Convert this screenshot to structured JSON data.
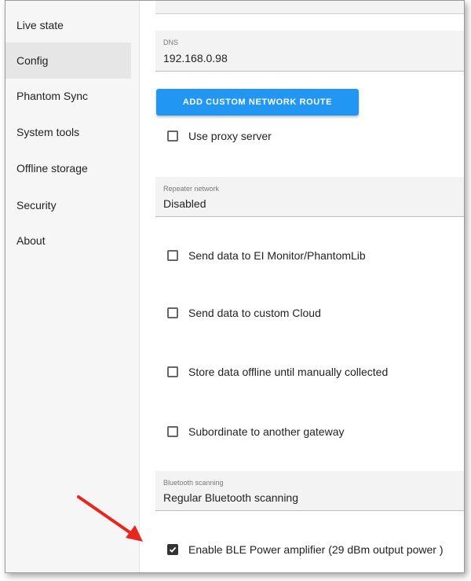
{
  "sidebar": {
    "items": [
      {
        "label": "Live state",
        "active": false
      },
      {
        "label": "Config",
        "active": true
      },
      {
        "label": "Phantom Sync",
        "active": false
      },
      {
        "label": "System tools",
        "active": false
      },
      {
        "label": "Offline storage",
        "active": false
      },
      {
        "label": "Security",
        "active": false
      },
      {
        "label": "About",
        "active": false
      }
    ]
  },
  "main": {
    "dns": {
      "label": "DNS",
      "value": "192.168.0.98"
    },
    "add_route_button": "ADD CUSTOM NETWORK ROUTE",
    "use_proxy": {
      "label": "Use proxy server",
      "checked": false
    },
    "repeater_network": {
      "label": "Repeater network",
      "value": "Disabled"
    },
    "send_ei_monitor": {
      "label": "Send data to EI Monitor/PhantomLib",
      "checked": false
    },
    "send_custom_cloud": {
      "label": "Send data to custom Cloud",
      "checked": false
    },
    "store_offline": {
      "label": "Store data offline until manually collected",
      "checked": false
    },
    "subordinate": {
      "label": "Subordinate to another gateway",
      "checked": false
    },
    "bluetooth_scanning": {
      "label": "Bluetooth scanning",
      "value": "Regular Bluetooth scanning"
    },
    "ble_power_amp": {
      "label": "Enable BLE Power amplifier (29 dBm output power )",
      "checked": true
    }
  },
  "colors": {
    "accent": "#2196f3",
    "annotation_arrow": "#e8261e"
  }
}
